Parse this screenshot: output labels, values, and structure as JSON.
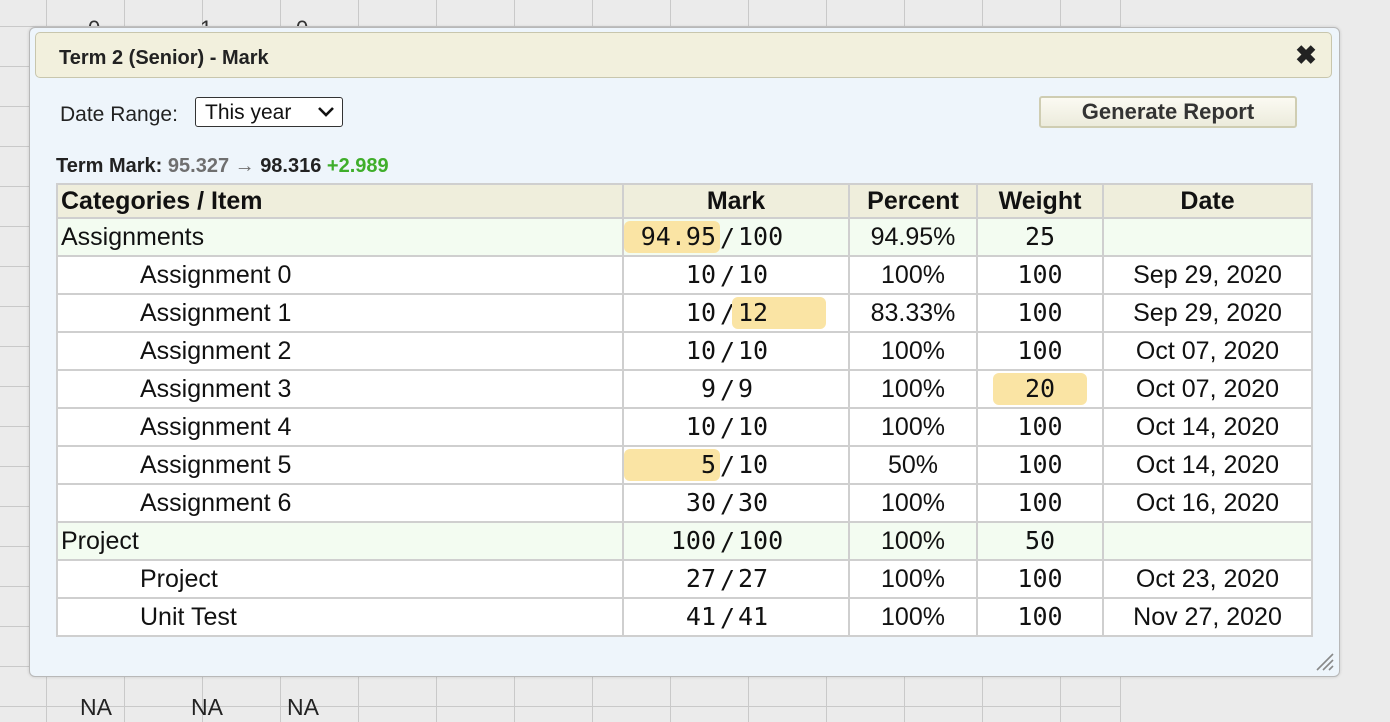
{
  "background": {
    "bottom_values": [
      "NA",
      "NA",
      "NA"
    ]
  },
  "dialog": {
    "title": "Term 2 (Senior) - Mark",
    "date_range_label": "Date Range:",
    "date_range_value": "This year",
    "generate_button": "Generate Report",
    "term_mark_label": "Term Mark:",
    "term_mark_old": "95.327",
    "term_mark_arrow": "→",
    "term_mark_new": "98.316",
    "term_mark_delta": "+2.989",
    "colors": {
      "highlight": "#fae4a4",
      "delta": "#3fae2a",
      "category_row": "#f3fcf1",
      "header": "#efeedc"
    }
  },
  "table": {
    "headers": [
      "Categories / Item",
      "Mark",
      "Percent",
      "Weight",
      "Date"
    ],
    "rows": [
      {
        "type": "category",
        "name": "Assignments",
        "score": "94.95",
        "out_of": "100",
        "percent": "94.95%",
        "weight": "25",
        "date": "",
        "hl_score": true
      },
      {
        "type": "item",
        "name": "Assignment 0",
        "score": "10",
        "out_of": "10",
        "percent": "100%",
        "weight": "100",
        "date": "Sep 29, 2020"
      },
      {
        "type": "item",
        "name": "Assignment 1",
        "score": "10",
        "out_of": "12",
        "percent": "83.33%",
        "weight": "100",
        "date": "Sep 29, 2020",
        "hl_out_of": true
      },
      {
        "type": "item",
        "name": "Assignment 2",
        "score": "10",
        "out_of": "10",
        "percent": "100%",
        "weight": "100",
        "date": "Oct 07, 2020"
      },
      {
        "type": "item",
        "name": "Assignment 3",
        "score": "9",
        "out_of": "9",
        "percent": "100%",
        "weight": "20",
        "date": "Oct 07, 2020",
        "hl_weight": true
      },
      {
        "type": "item",
        "name": "Assignment 4",
        "score": "10",
        "out_of": "10",
        "percent": "100%",
        "weight": "100",
        "date": "Oct 14, 2020"
      },
      {
        "type": "item",
        "name": "Assignment 5",
        "score": "5",
        "out_of": "10",
        "percent": "50%",
        "weight": "100",
        "date": "Oct 14, 2020",
        "hl_score": true
      },
      {
        "type": "item",
        "name": "Assignment 6",
        "score": "30",
        "out_of": "30",
        "percent": "100%",
        "weight": "100",
        "date": "Oct 16, 2020"
      },
      {
        "type": "category",
        "name": "Project",
        "score": "100",
        "out_of": "100",
        "percent": "100%",
        "weight": "50",
        "date": ""
      },
      {
        "type": "item",
        "name": "Project",
        "score": "27",
        "out_of": "27",
        "percent": "100%",
        "weight": "100",
        "date": "Oct 23, 2020"
      },
      {
        "type": "item",
        "name": "Unit Test",
        "score": "41",
        "out_of": "41",
        "percent": "100%",
        "weight": "100",
        "date": "Nov 27, 2020"
      }
    ]
  }
}
